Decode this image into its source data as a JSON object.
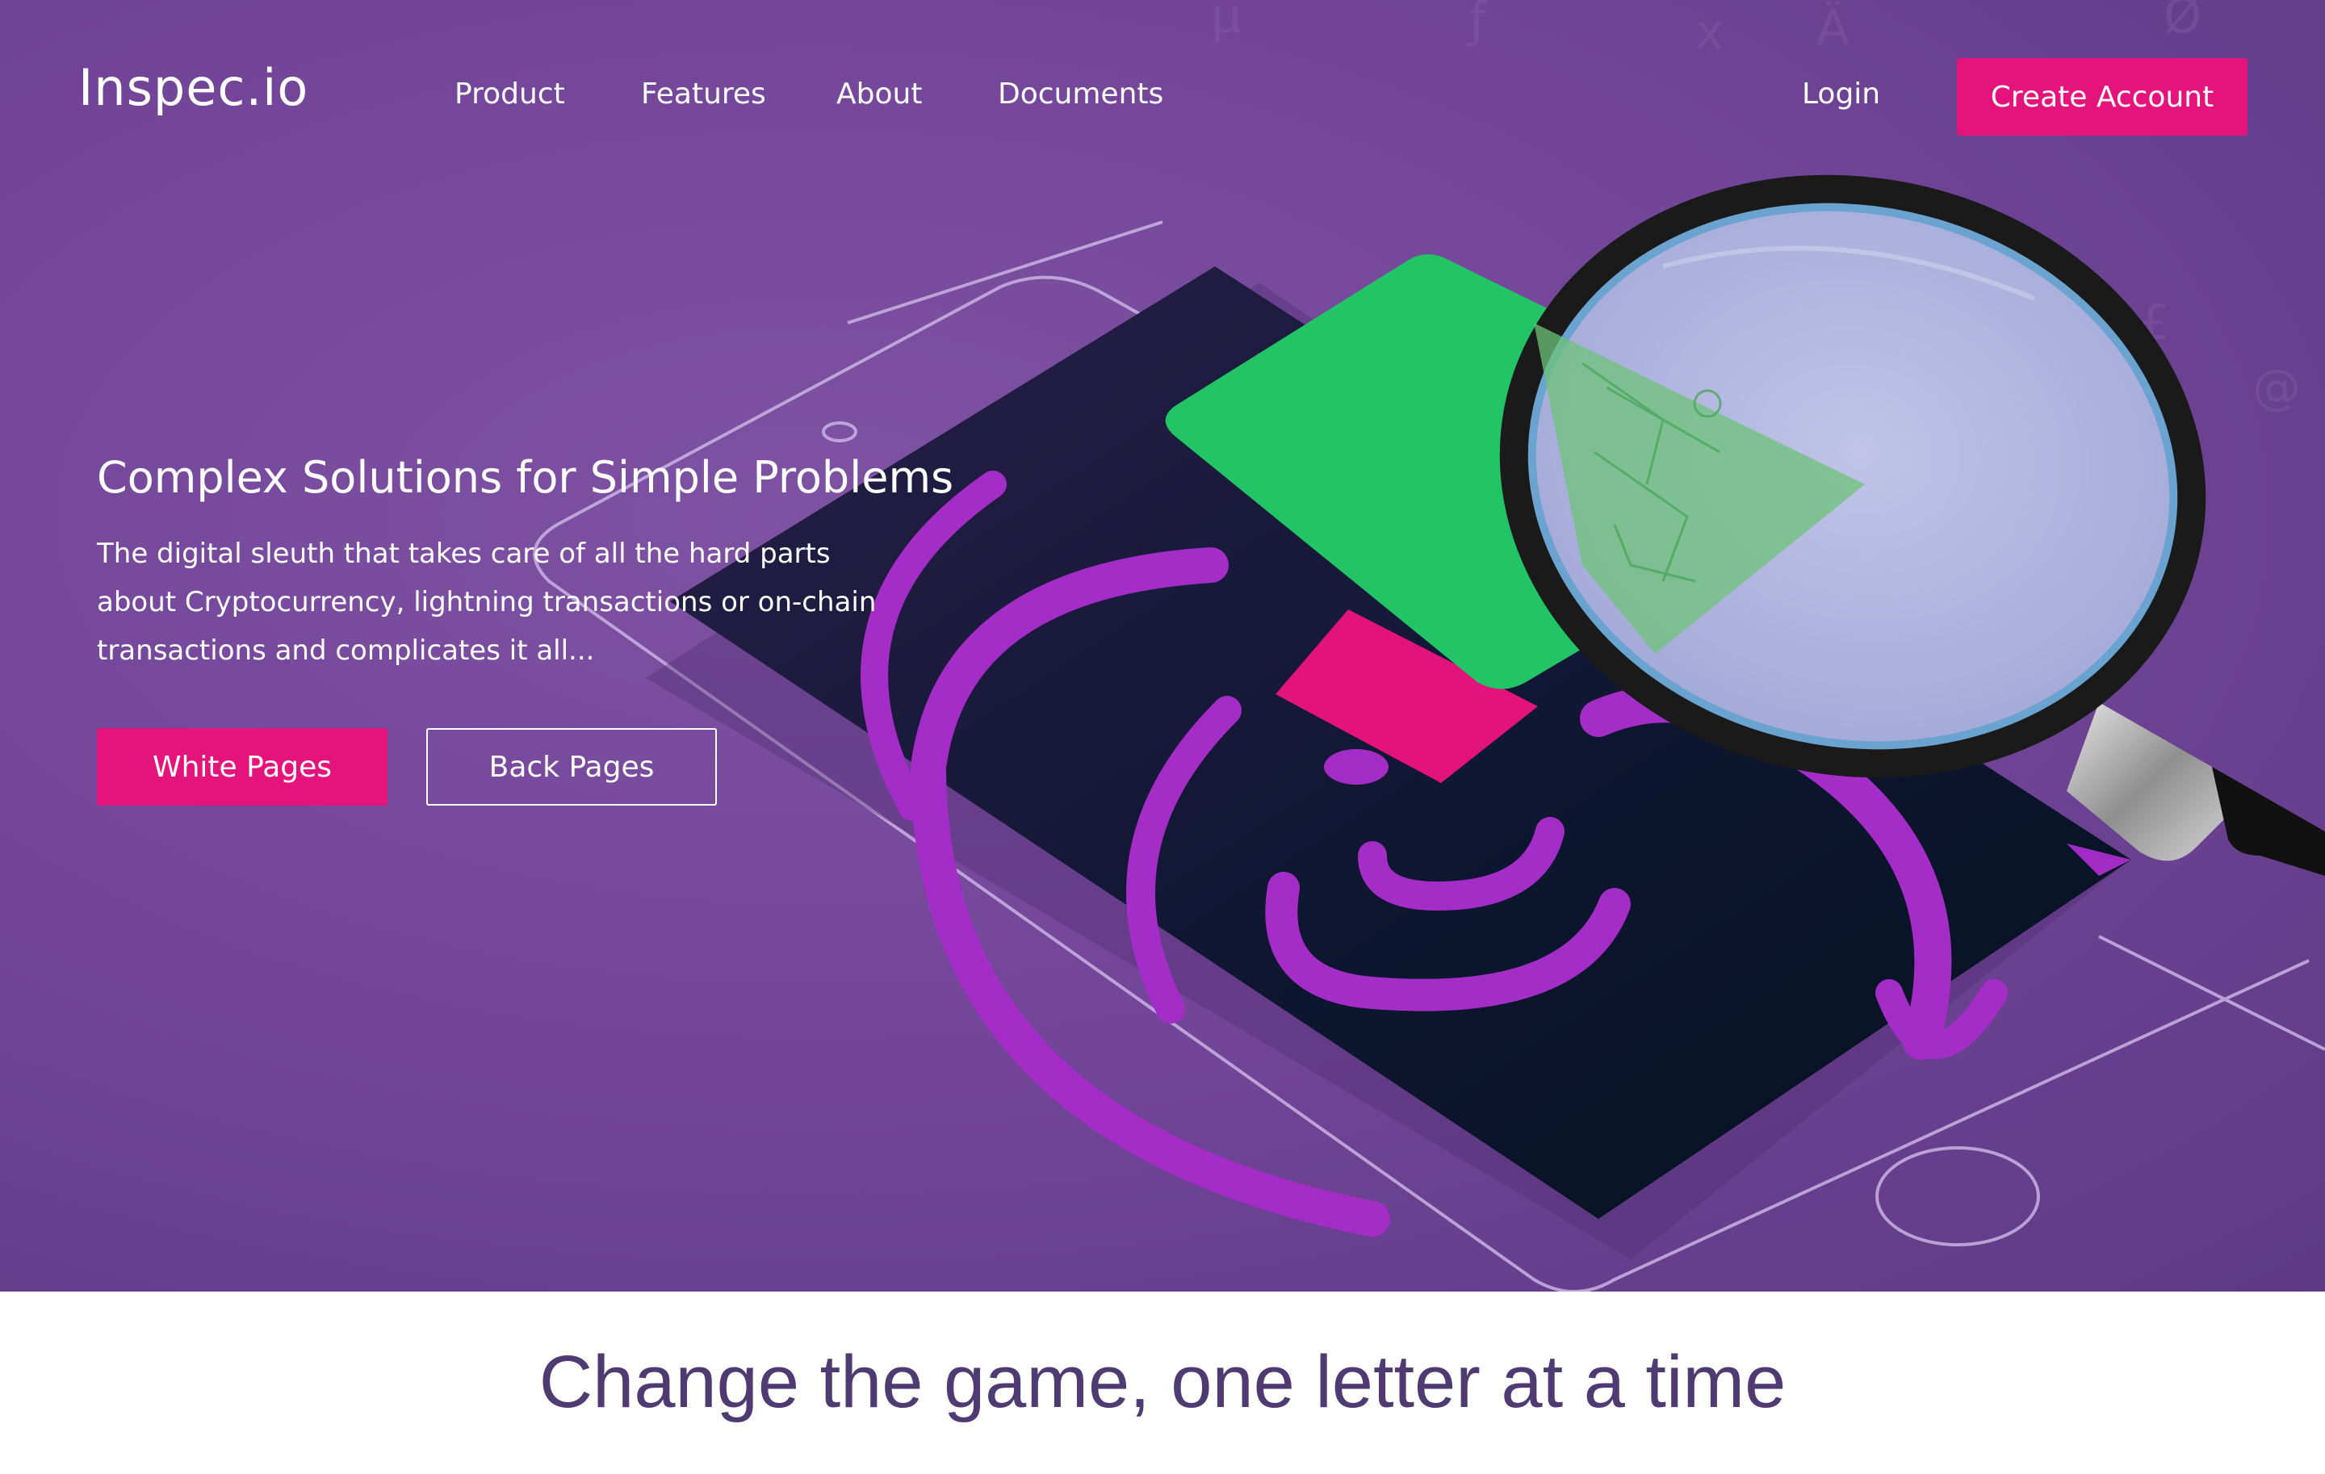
{
  "nav": {
    "logo": "Inspec.io",
    "links": [
      "Product",
      "Features",
      "About",
      "Documents"
    ],
    "login": "Login",
    "create_account": "Create Account"
  },
  "hero": {
    "title": "Complex Solutions for Simple Problems",
    "description": "The digital sleuth that takes care of all the hard parts about Cryptocurrency, lightning transactions or on-chain transactions and complicates it all...",
    "primary_button": "White Pages",
    "secondary_button": "Back Pages"
  },
  "tagline": "Change the game, one letter at a time",
  "colors": {
    "accent": "#e5137c",
    "hero_purple": "#74469a",
    "tagline": "#4f3b72",
    "green_card": "#22c466"
  },
  "icons": {
    "hero_illustration": "magnifying-glass-over-phone"
  }
}
